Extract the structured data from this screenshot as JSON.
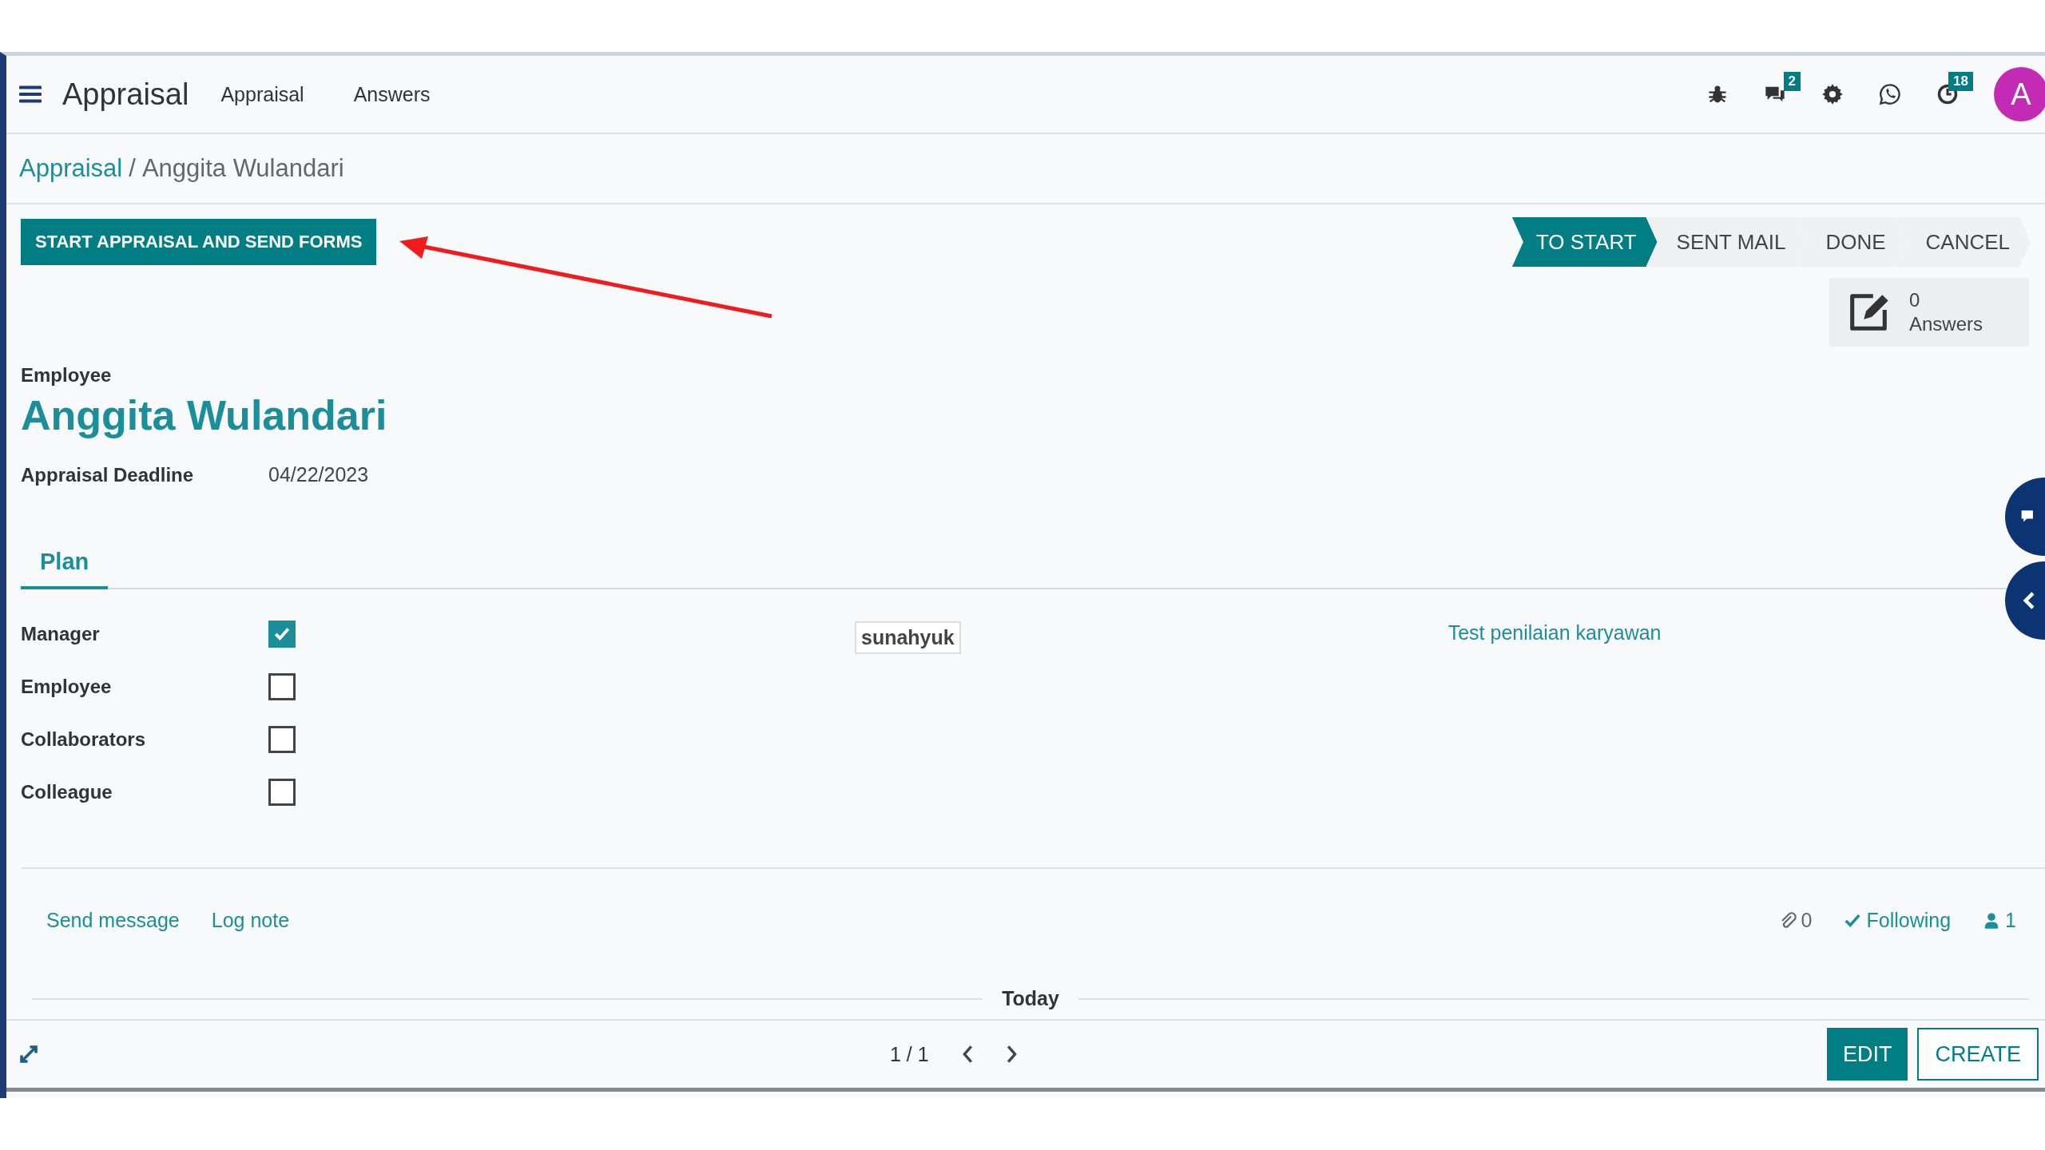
{
  "app": {
    "title": "Appraisal",
    "menu": [
      "Appraisal",
      "Answers"
    ]
  },
  "systray": {
    "chat_badge": "2",
    "activity_badge": "18",
    "avatar": "A"
  },
  "breadcrumb": {
    "parent": "Appraisal",
    "separator": "/",
    "current": "Anggita Wulandari"
  },
  "primary_button": "START APPRAISAL AND SEND FORMS",
  "stages": [
    {
      "label": "TO START",
      "selected": true
    },
    {
      "label": "SENT MAIL",
      "selected": false
    },
    {
      "label": "DONE",
      "selected": false
    },
    {
      "label": "CANCEL",
      "selected": false
    }
  ],
  "answers_button": {
    "count": "0",
    "label": "Answers"
  },
  "employee": {
    "label": "Employee",
    "name": "Anggita Wulandari"
  },
  "deadline": {
    "label": "Appraisal Deadline",
    "value": "04/22/2023"
  },
  "tabs": [
    {
      "label": "Plan",
      "selected": true
    }
  ],
  "plan": [
    {
      "label": "Manager",
      "checked": true
    },
    {
      "label": "Employee",
      "checked": false
    },
    {
      "label": "Collaborators",
      "checked": false
    },
    {
      "label": "Colleague",
      "checked": false
    }
  ],
  "manager_tag": "sunahyuk",
  "survey_link": "Test penilaian karyawan",
  "chatter": {
    "actions": [
      "Send message",
      "Log note"
    ],
    "attachments": "0",
    "following": "Following",
    "followers": "1",
    "date_separator": "Today"
  },
  "pager": "1 / 1",
  "bottom_buttons": [
    {
      "label": "EDIT",
      "kind": "primary"
    },
    {
      "label": "CREATE",
      "kind": "secondary"
    }
  ]
}
